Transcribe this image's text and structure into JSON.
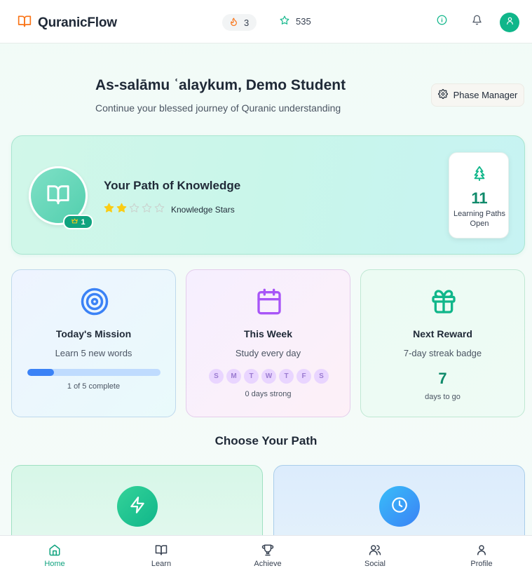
{
  "header": {
    "app_name": "QuranicFlow",
    "streak_count": "3",
    "star_points": "535"
  },
  "greeting": {
    "title": "As-salāmu ʿalaykum, Demo Student",
    "subtitle": "Continue your blessed journey of Quranic understanding",
    "phase_button": "Phase Manager"
  },
  "knowledge": {
    "title": "Your Path of Knowledge",
    "level": "1",
    "stars_filled": 2,
    "stars_total": 5,
    "stars_label": "Knowledge Stars",
    "paths_open": "11",
    "paths_label": "Learning Paths Open"
  },
  "mission": {
    "title": "Today's Mission",
    "subtitle": "Learn 5 new words",
    "progress_fraction": 0.2,
    "caption": "1 of 5 complete"
  },
  "week": {
    "title": "This Week",
    "subtitle": "Study every day",
    "days": [
      "S",
      "M",
      "T",
      "W",
      "T",
      "F",
      "S"
    ],
    "caption": "0 days strong"
  },
  "reward": {
    "title": "Next Reward",
    "subtitle": "7-day streak badge",
    "days_left": "7",
    "caption": "days to go"
  },
  "choose": {
    "title": "Choose Your Path"
  },
  "nav": {
    "home": "Home",
    "learn": "Learn",
    "achieve": "Achieve",
    "social": "Social",
    "profile": "Profile"
  },
  "colors": {
    "brand_green": "#10b68a",
    "accent_orange": "#f97316",
    "mission_blue": "#3b82f6",
    "week_purple": "#a855f7",
    "star_gold": "#facc15"
  }
}
